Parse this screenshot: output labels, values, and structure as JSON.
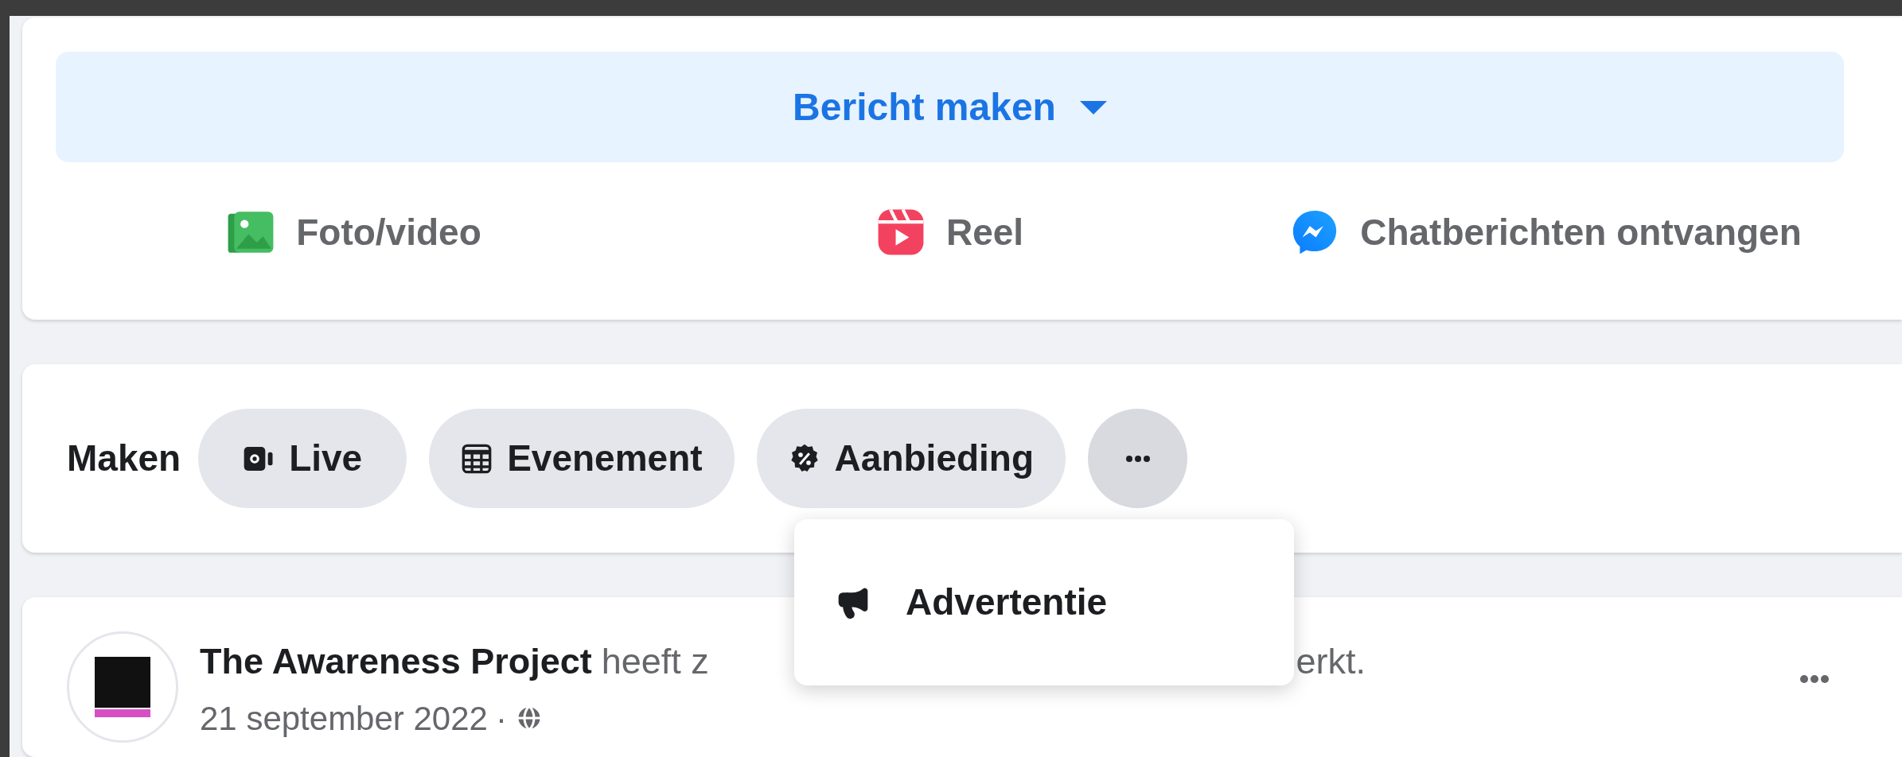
{
  "composer": {
    "button": "Bericht maken",
    "actions": [
      {
        "kind": "photo",
        "label": "Foto/video"
      },
      {
        "kind": "reel",
        "label": "Reel"
      },
      {
        "kind": "messenger",
        "label": "Chatberichten ontvangen"
      }
    ]
  },
  "create": {
    "label": "Maken",
    "items": [
      {
        "kind": "live",
        "label": "Live"
      },
      {
        "kind": "event",
        "label": "Evenement"
      },
      {
        "kind": "offer",
        "label": "Aanbieding"
      }
    ],
    "more": {
      "expanded": true
    },
    "menu": [
      {
        "kind": "ad",
        "label": "Advertentie"
      }
    ]
  },
  "post": {
    "author": "The Awareness Project",
    "text_start": "heeft z",
    "text_end": "erkt.",
    "date": "21 september 2022",
    "date_separator": "·"
  }
}
